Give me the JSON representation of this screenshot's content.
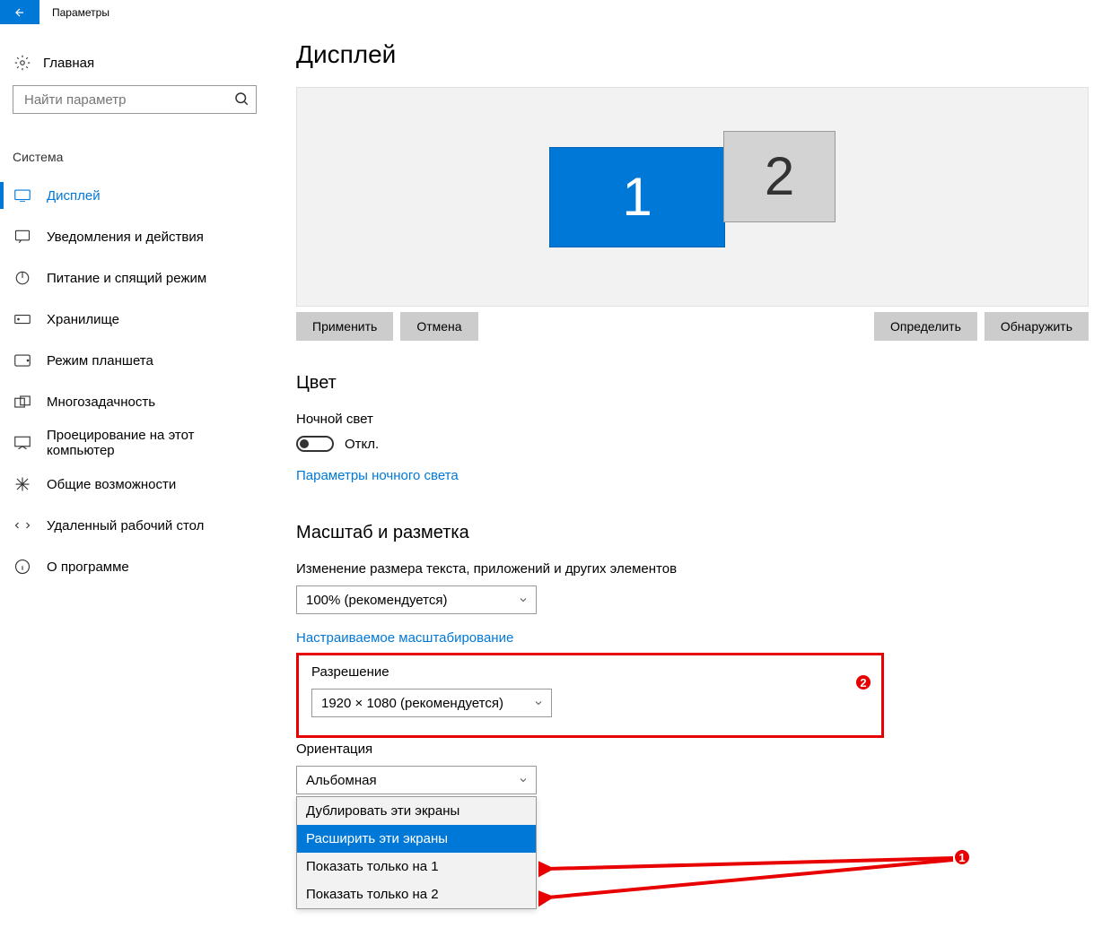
{
  "window": {
    "title": "Параметры"
  },
  "sidebar": {
    "home_label": "Главная",
    "search_placeholder": "Найти параметр",
    "section_title": "Система",
    "items": [
      {
        "label": "Дисплей"
      },
      {
        "label": "Уведомления и действия"
      },
      {
        "label": "Питание и спящий режим"
      },
      {
        "label": "Хранилище"
      },
      {
        "label": "Режим планшета"
      },
      {
        "label": "Многозадачность"
      },
      {
        "label": "Проецирование на этот компьютер"
      },
      {
        "label": "Общие возможности"
      },
      {
        "label": "Удаленный рабочий стол"
      },
      {
        "label": "О программе"
      }
    ]
  },
  "main": {
    "title": "Дисплей",
    "monitors": {
      "m1": "1",
      "m2": "2"
    },
    "buttons": {
      "apply": "Применить",
      "cancel": "Отмена",
      "identify": "Определить",
      "detect": "Обнаружить"
    },
    "color": {
      "heading": "Цвет",
      "night_light_label": "Ночной свет",
      "toggle_text": "Откл.",
      "settings_link": "Параметры ночного света"
    },
    "scale": {
      "heading": "Масштаб и разметка",
      "size_label": "Изменение размера текста, приложений и других элементов",
      "size_value": "100% (рекомендуется)",
      "custom_link": "Настраиваемое масштабирование",
      "resolution_label": "Разрешение",
      "resolution_value": "1920 × 1080 (рекомендуется)",
      "orientation_label": "Ориентация",
      "orientation_value": "Альбомная"
    },
    "multi_options": [
      "Дублировать эти экраны",
      "Расширить эти экраны",
      "Показать только на 1",
      "Показать только на 2"
    ],
    "markers": {
      "m1": "1",
      "m2": "2"
    }
  }
}
